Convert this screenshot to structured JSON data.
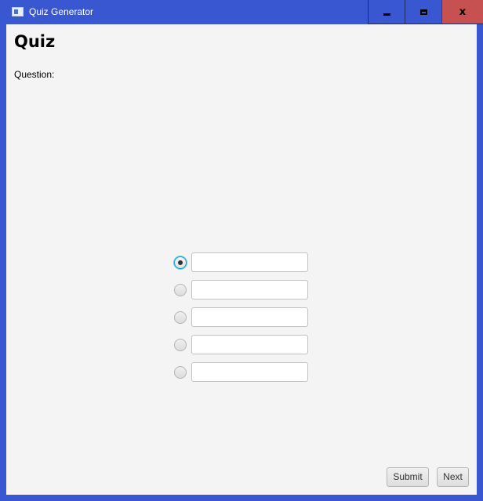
{
  "window": {
    "title": "Quiz Generator",
    "controls": {
      "minimize_icon": "minimize-icon",
      "maximize_icon": "maximize-icon",
      "close_icon": "close-icon",
      "close_glyph": "x"
    },
    "titlebar_color": "#3a57d2",
    "close_button_color": "#c75050"
  },
  "main": {
    "heading": "Quiz",
    "question_label": "Question:",
    "question_text": "",
    "options": [
      {
        "selected": true,
        "value": ""
      },
      {
        "selected": false,
        "value": ""
      },
      {
        "selected": false,
        "value": ""
      },
      {
        "selected": false,
        "value": ""
      },
      {
        "selected": false,
        "value": ""
      }
    ],
    "buttons": {
      "submit_label": "Submit",
      "next_label": "Next"
    },
    "background_color": "#f4f4f4",
    "selection_accent": "#039ed3"
  }
}
